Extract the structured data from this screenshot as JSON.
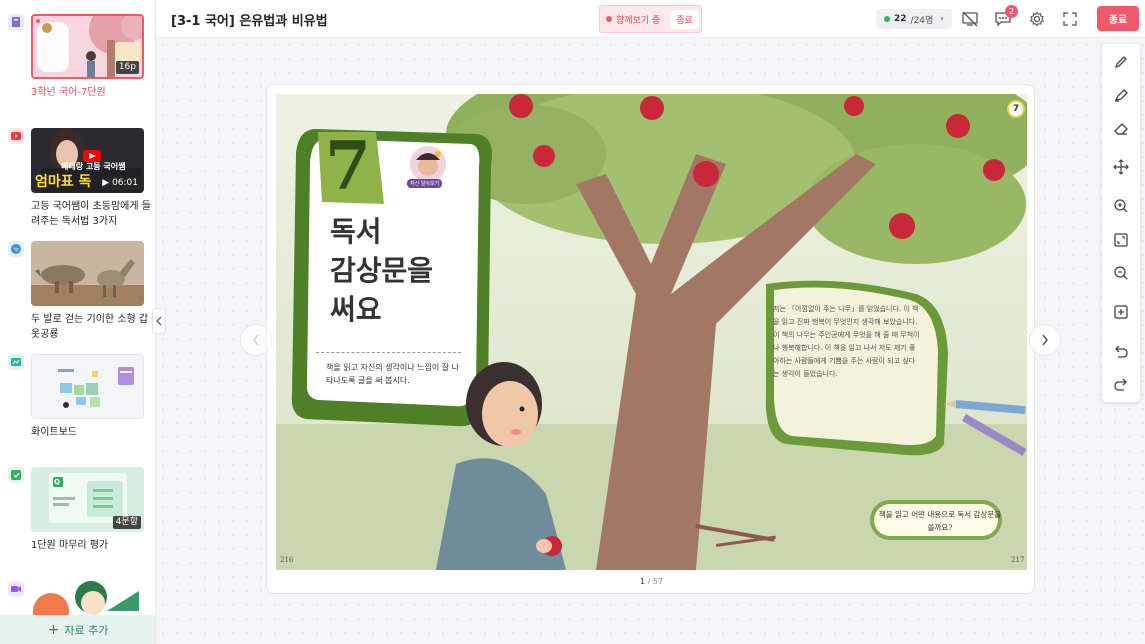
{
  "sidebar": {
    "items": [
      {
        "title": "3학년 국어-7단원",
        "badge": "16p",
        "type": "book",
        "type_color": "#7b6fd6"
      },
      {
        "title": "고등 국어쌤이 초등맘에게 들려주는 독서법 3가지",
        "badge": "06:01",
        "type": "youtube",
        "type_color": "#ef3b3b",
        "overlay_text": "배테랑 고등 국어쌤 엄마표 독"
      },
      {
        "title": "두 발로 걷는 기이한 소형 갑옷공룡",
        "badge": "",
        "type": "web",
        "type_color": "#3a8ee6"
      },
      {
        "title": "화이트보드",
        "badge": "",
        "type": "whiteboard",
        "type_color": "#2fb1a8"
      },
      {
        "title": "1단원 마무리 평가",
        "badge": "4문항",
        "type": "quiz",
        "type_color": "#2fb15f",
        "thumb_letter": "Q"
      },
      {
        "title": "",
        "badge": "",
        "type": "video",
        "type_color": "#8b5cf6"
      }
    ],
    "add_label": "자료 추가"
  },
  "header": {
    "title": "[3-1 국어] 은유법과 비유법",
    "together_label": "함께보기 중",
    "together_end": "종료",
    "users_current": "22",
    "users_total": "/24명",
    "notification_count": "2",
    "exit_label": "종료"
  },
  "viewer": {
    "page_current": "1",
    "page_total": " / 57",
    "book": {
      "chapter": "7",
      "title_line1": "독서",
      "title_line2": "감상문을",
      "title_line3": "써요",
      "subtitle": "책을 읽고 자신의 생각이나 느낌이 잘 나타나도록 글을 써 봅시다.",
      "char_label": "자신 알아보기",
      "bubble_text": "저는 「아낌없이 주는 나무」를 읽었습니다. 이 책을 읽고 진짜 행복이 무엇인지 생각해 보았습니다. 이 책의 나무는 주인공에게 무엇을 해 줄 때 무척이나 행복해합니다. 이 책을 읽고 나서 저도 제가 좋아하는 사람들에게 기쁨을 주는 사람이 되고 싶다는 생각이 들었습니다.",
      "question": "책을 읽고 어떤 내용으로 독서 감상문을 쓸까요?",
      "left_page_number": "216",
      "right_page_number": "217",
      "corner_number": "7"
    }
  },
  "toolbar": {
    "tools": [
      "pen-icon",
      "highlighter-icon",
      "eraser-icon",
      "move-icon",
      "zoom-in-icon",
      "fit-screen-icon",
      "zoom-out-icon",
      "add-page-icon",
      "undo-icon",
      "redo-icon"
    ]
  },
  "colors": {
    "accent": "#ef5a6a",
    "green": "#2fb15f"
  }
}
